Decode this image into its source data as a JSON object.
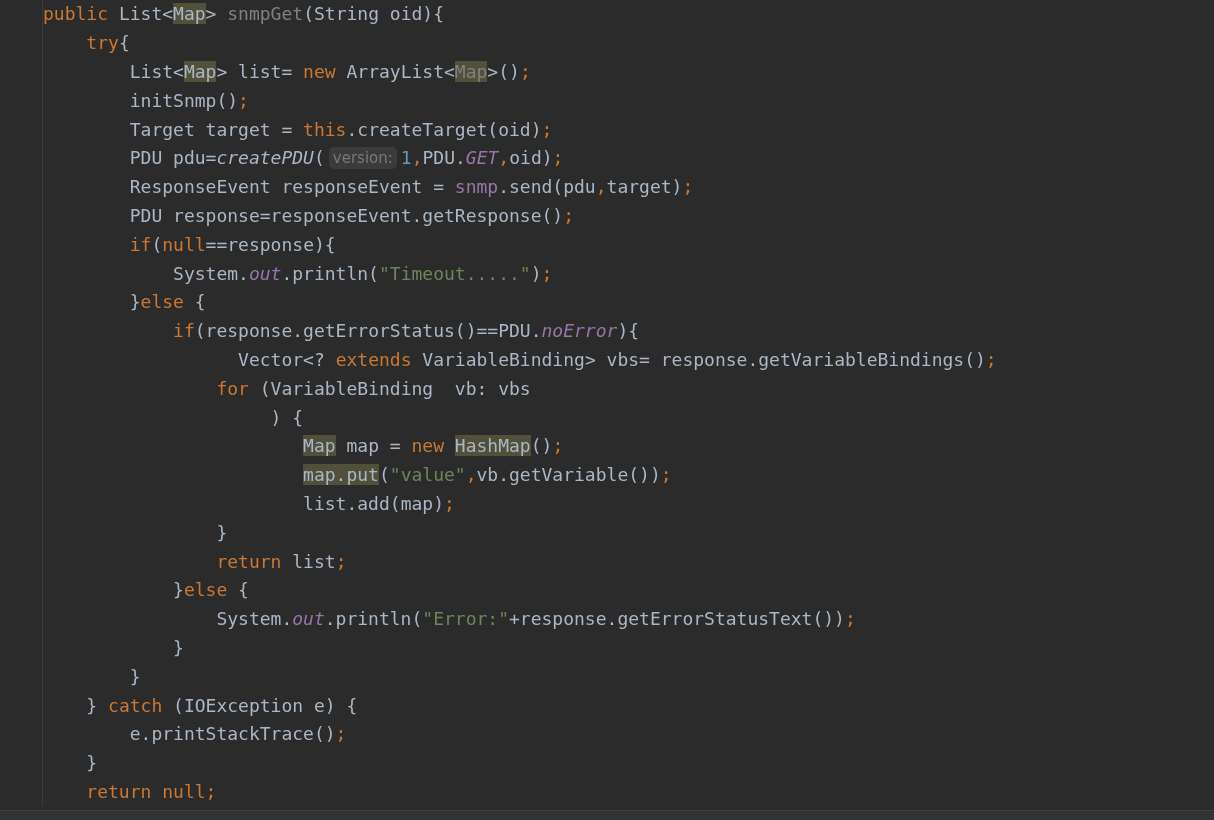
{
  "editor": {
    "lines": [
      [
        {
          "text": "public",
          "kind": "keyword"
        },
        {
          "text": " List<",
          "kind": "plain"
        },
        {
          "text": "Map",
          "kind": "usage"
        },
        {
          "text": "> ",
          "kind": "plain"
        },
        {
          "text": "snmpGet",
          "kind": "unused"
        },
        {
          "text": "(String oid){",
          "kind": "plain"
        }
      ],
      [
        {
          "text": "    try",
          "kind": "keyword"
        },
        {
          "text": "{",
          "kind": "plain"
        }
      ],
      [
        {
          "text": "        List<",
          "kind": "plain"
        },
        {
          "text": "Map",
          "kind": "usage"
        },
        {
          "text": "> list= ",
          "kind": "plain"
        },
        {
          "text": "new",
          "kind": "keyword"
        },
        {
          "text": " ArrayList<",
          "kind": "plain"
        },
        {
          "text": "Map",
          "kind": "usage-dim"
        },
        {
          "text": ">()",
          "kind": "plain"
        },
        {
          "text": ";",
          "kind": "punct"
        }
      ],
      [
        {
          "text": "        initSnmp()",
          "kind": "plain"
        },
        {
          "text": ";",
          "kind": "punct"
        }
      ],
      [
        {
          "text": "        Target target = ",
          "kind": "plain"
        },
        {
          "text": "this",
          "kind": "keyword"
        },
        {
          "text": ".createTarget(oid)",
          "kind": "plain"
        },
        {
          "text": ";",
          "kind": "punct"
        }
      ],
      [
        {
          "text": "        PDU pdu=",
          "kind": "plain"
        },
        {
          "text": "createPDU",
          "kind": "static-call"
        },
        {
          "text": "(",
          "kind": "plain"
        },
        {
          "text": "version:",
          "kind": "hint"
        },
        {
          "text": "1",
          "kind": "number"
        },
        {
          "text": ",",
          "kind": "punct"
        },
        {
          "text": "PDU.",
          "kind": "plain"
        },
        {
          "text": "GET",
          "kind": "field"
        },
        {
          "text": ",",
          "kind": "punct"
        },
        {
          "text": "oid)",
          "kind": "plain"
        },
        {
          "text": ";",
          "kind": "punct"
        }
      ],
      [
        {
          "text": "        ResponseEvent responseEvent = ",
          "kind": "plain"
        },
        {
          "text": "snmp",
          "kind": "member"
        },
        {
          "text": ".send(pdu",
          "kind": "plain"
        },
        {
          "text": ",",
          "kind": "punct"
        },
        {
          "text": "target)",
          "kind": "plain"
        },
        {
          "text": ";",
          "kind": "punct"
        }
      ],
      [
        {
          "text": "        PDU response=responseEvent.getResponse()",
          "kind": "plain"
        },
        {
          "text": ";",
          "kind": "punct"
        }
      ],
      [
        {
          "text": "        if",
          "kind": "keyword"
        },
        {
          "text": "(",
          "kind": "plain"
        },
        {
          "text": "null",
          "kind": "keyword"
        },
        {
          "text": "==response){",
          "kind": "plain"
        }
      ],
      [
        {
          "text": "            System.",
          "kind": "plain"
        },
        {
          "text": "out",
          "kind": "field"
        },
        {
          "text": ".println(",
          "kind": "plain"
        },
        {
          "text": "\"Timeout.....\"",
          "kind": "string"
        },
        {
          "text": ")",
          "kind": "plain"
        },
        {
          "text": ";",
          "kind": "punct"
        }
      ],
      [
        {
          "text": "        }",
          "kind": "plain"
        },
        {
          "text": "else",
          "kind": "keyword"
        },
        {
          "text": " {",
          "kind": "plain"
        }
      ],
      [
        {
          "text": "            if",
          "kind": "keyword"
        },
        {
          "text": "(response.getErrorStatus()==PDU.",
          "kind": "plain"
        },
        {
          "text": "noError",
          "kind": "field"
        },
        {
          "text": "){",
          "kind": "plain"
        }
      ],
      [
        {
          "text": "                  Vector<? ",
          "kind": "plain"
        },
        {
          "text": "extends",
          "kind": "keyword"
        },
        {
          "text": " VariableBinding> vbs= response.getVariableBindings()",
          "kind": "plain"
        },
        {
          "text": ";",
          "kind": "punct"
        }
      ],
      [
        {
          "text": "                for",
          "kind": "keyword"
        },
        {
          "text": " (VariableBinding  vb: vbs",
          "kind": "plain"
        }
      ],
      [
        {
          "text": "                     ) {",
          "kind": "plain"
        }
      ],
      [
        {
          "text": "                        Map",
          "kind": "usage"
        },
        {
          "text": " map = ",
          "kind": "plain"
        },
        {
          "text": "new ",
          "kind": "keyword"
        },
        {
          "text": "HashMap",
          "kind": "usage"
        },
        {
          "text": "()",
          "kind": "plain"
        },
        {
          "text": ";",
          "kind": "punct"
        }
      ],
      [
        {
          "text": "                        map.put",
          "kind": "usage"
        },
        {
          "text": "(",
          "kind": "plain"
        },
        {
          "text": "\"value\"",
          "kind": "string"
        },
        {
          "text": ",",
          "kind": "punct"
        },
        {
          "text": "vb.getVariable())",
          "kind": "plain"
        },
        {
          "text": ";",
          "kind": "punct"
        }
      ],
      [
        {
          "text": "                        list.add(map)",
          "kind": "plain"
        },
        {
          "text": ";",
          "kind": "punct"
        }
      ],
      [
        {
          "text": "                }",
          "kind": "plain"
        }
      ],
      [
        {
          "text": "                return",
          "kind": "keyword"
        },
        {
          "text": " list",
          "kind": "plain"
        },
        {
          "text": ";",
          "kind": "punct"
        }
      ],
      [
        {
          "text": "            }",
          "kind": "plain"
        },
        {
          "text": "else",
          "kind": "keyword"
        },
        {
          "text": " {",
          "kind": "plain"
        }
      ],
      [
        {
          "text": "                System.",
          "kind": "plain"
        },
        {
          "text": "out",
          "kind": "field"
        },
        {
          "text": ".println(",
          "kind": "plain"
        },
        {
          "text": "\"Error:\"",
          "kind": "string"
        },
        {
          "text": "+response.getErrorStatusText())",
          "kind": "plain"
        },
        {
          "text": ";",
          "kind": "punct"
        }
      ],
      [
        {
          "text": "            }",
          "kind": "plain"
        }
      ],
      [
        {
          "text": "        }",
          "kind": "plain"
        }
      ],
      [
        {
          "text": "    } ",
          "kind": "plain"
        },
        {
          "text": "catch",
          "kind": "keyword"
        },
        {
          "text": " (IOException e) {",
          "kind": "plain"
        }
      ],
      [
        {
          "text": "        e.printStackTrace()",
          "kind": "plain"
        },
        {
          "text": ";",
          "kind": "punct"
        }
      ],
      [
        {
          "text": "    }",
          "kind": "plain"
        }
      ],
      [
        {
          "text": "    return null",
          "kind": "keyword"
        },
        {
          "text": ";",
          "kind": "punct"
        }
      ]
    ]
  }
}
